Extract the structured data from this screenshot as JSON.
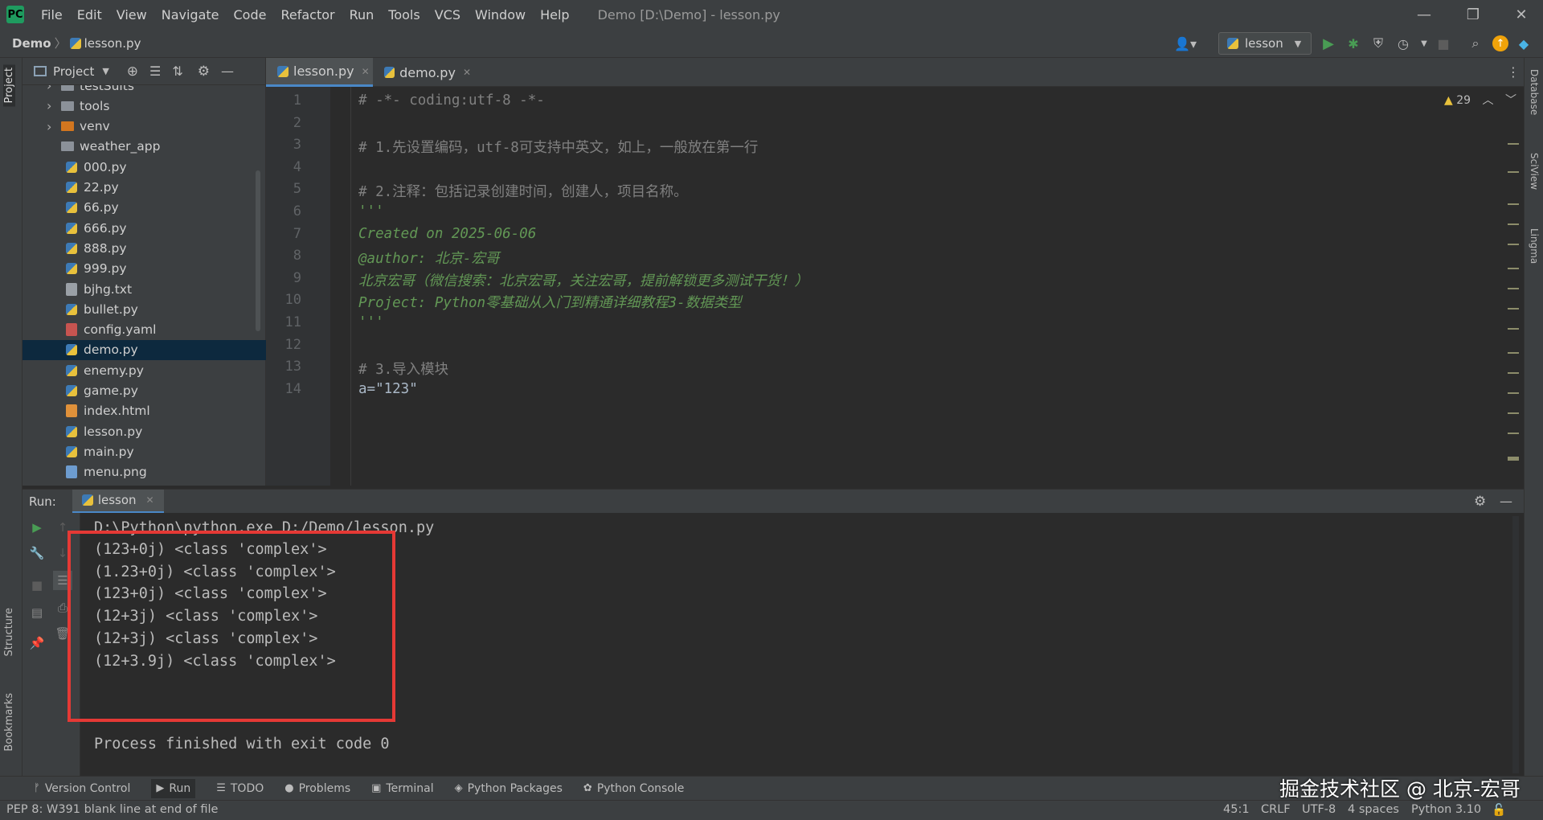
{
  "menubar": {
    "logo_text": "PC",
    "items": [
      "File",
      "Edit",
      "View",
      "Navigate",
      "Code",
      "Refactor",
      "Run",
      "Tools",
      "VCS",
      "Window",
      "Help"
    ],
    "window_title": "Demo [D:\\Demo] - lesson.py"
  },
  "navbar": {
    "breadcrumb_project": "Demo",
    "breadcrumb_sep": "〉",
    "breadcrumb_file": "lesson.py",
    "run_config": "lesson"
  },
  "stripes": {
    "left_project": "Project",
    "left_structure": "Structure",
    "left_bookmarks": "Bookmarks",
    "right_database": "Database",
    "right_sciview": "SciView",
    "right_lingma": "Lingma"
  },
  "project": {
    "title": "Project",
    "items": [
      {
        "name": "testSuits",
        "kind": "folder",
        "arrow": "›"
      },
      {
        "name": "tools",
        "kind": "folder",
        "arrow": "›"
      },
      {
        "name": "venv",
        "kind": "venv",
        "arrow": "›"
      },
      {
        "name": "weather_app",
        "kind": "folder",
        "arrow": ""
      },
      {
        "name": "000.py",
        "kind": "py"
      },
      {
        "name": "22.py",
        "kind": "py"
      },
      {
        "name": "66.py",
        "kind": "py"
      },
      {
        "name": "666.py",
        "kind": "py"
      },
      {
        "name": "888.py",
        "kind": "py"
      },
      {
        "name": "999.py",
        "kind": "py"
      },
      {
        "name": "bjhg.txt",
        "kind": "txt"
      },
      {
        "name": "bullet.py",
        "kind": "py"
      },
      {
        "name": "config.yaml",
        "kind": "yaml"
      },
      {
        "name": "demo.py",
        "kind": "py",
        "selected": true
      },
      {
        "name": "enemy.py",
        "kind": "py"
      },
      {
        "name": "game.py",
        "kind": "py"
      },
      {
        "name": "index.html",
        "kind": "html"
      },
      {
        "name": "lesson.py",
        "kind": "py"
      },
      {
        "name": "main.py",
        "kind": "py"
      },
      {
        "name": "menu.png",
        "kind": "png"
      }
    ]
  },
  "tabs": [
    {
      "label": "lesson.py",
      "active": true
    },
    {
      "label": "demo.py",
      "active": false
    }
  ],
  "editor": {
    "warnings_count": "29",
    "lines": [
      {
        "n": "1",
        "cls": "c-comment",
        "text": "# -*- coding:utf-8 -*-"
      },
      {
        "n": "2",
        "cls": "c-plain",
        "text": ""
      },
      {
        "n": "3",
        "cls": "c-comment",
        "text": "# 1.先设置编码，utf-8可支持中英文，如上，一般放在第一行"
      },
      {
        "n": "4",
        "cls": "c-plain",
        "text": ""
      },
      {
        "n": "5",
        "cls": "c-comment",
        "text": "# 2.注释：包括记录创建时间，创建人，项目名称。"
      },
      {
        "n": "6",
        "cls": "c-doc",
        "text": "'''"
      },
      {
        "n": "7",
        "cls": "c-doc",
        "text": "Created on 2025-06-06"
      },
      {
        "n": "8",
        "cls": "c-doc",
        "text": "@author: 北京-宏哥"
      },
      {
        "n": "9",
        "cls": "c-doc",
        "text": "北京宏哥（微信搜索：北京宏哥，关注宏哥，提前解锁更多测试干货！）"
      },
      {
        "n": "10",
        "cls": "c-doc",
        "text": "Project: Python零基础从入门到精通详细教程3-数据类型"
      },
      {
        "n": "11",
        "cls": "c-doc",
        "text": "'''"
      },
      {
        "n": "12",
        "cls": "c-plain",
        "text": ""
      },
      {
        "n": "13",
        "cls": "c-comment",
        "text": "# 3.导入模块"
      },
      {
        "n": "14",
        "cls": "c-plain",
        "text": "a=\"123\""
      }
    ]
  },
  "run": {
    "label": "Run:",
    "tab": "lesson",
    "command": "D:\\Python\\python.exe D:/Demo/lesson.py",
    "output": [
      "(123+0j) <class 'complex'>",
      "(1.23+0j) <class 'complex'>",
      "(123+0j) <class 'complex'>",
      "(12+3j) <class 'complex'>",
      "(12+3j) <class 'complex'>",
      "(12+3.9j) <class 'complex'>"
    ],
    "exit": "Process finished with exit code 0"
  },
  "bottom_tabs": [
    {
      "label": "Version Control",
      "icon": "branch-icon",
      "glyph": "ᚠ"
    },
    {
      "label": "Run",
      "icon": "run-icon",
      "glyph": "▶"
    },
    {
      "label": "TODO",
      "icon": "list-icon",
      "glyph": "☰"
    },
    {
      "label": "Problems",
      "icon": "info-icon",
      "glyph": "●"
    },
    {
      "label": "Terminal",
      "icon": "terminal-icon",
      "glyph": "▣"
    },
    {
      "label": "Python Packages",
      "icon": "layers-icon",
      "glyph": "◈"
    },
    {
      "label": "Python Console",
      "icon": "python-icon",
      "glyph": "✿"
    }
  ],
  "status": {
    "message": "PEP 8: W391 blank line at end of file",
    "position": "45:1",
    "line_sep": "CRLF",
    "encoding": "UTF-8",
    "indent": "4 spaces",
    "interpreter": "Python 3.10"
  },
  "watermark": "掘金技术社区 @ 北京-宏哥",
  "colors": {
    "accent_red": "#e53935",
    "selection": "#0d293e",
    "run_green": "#499c54"
  }
}
